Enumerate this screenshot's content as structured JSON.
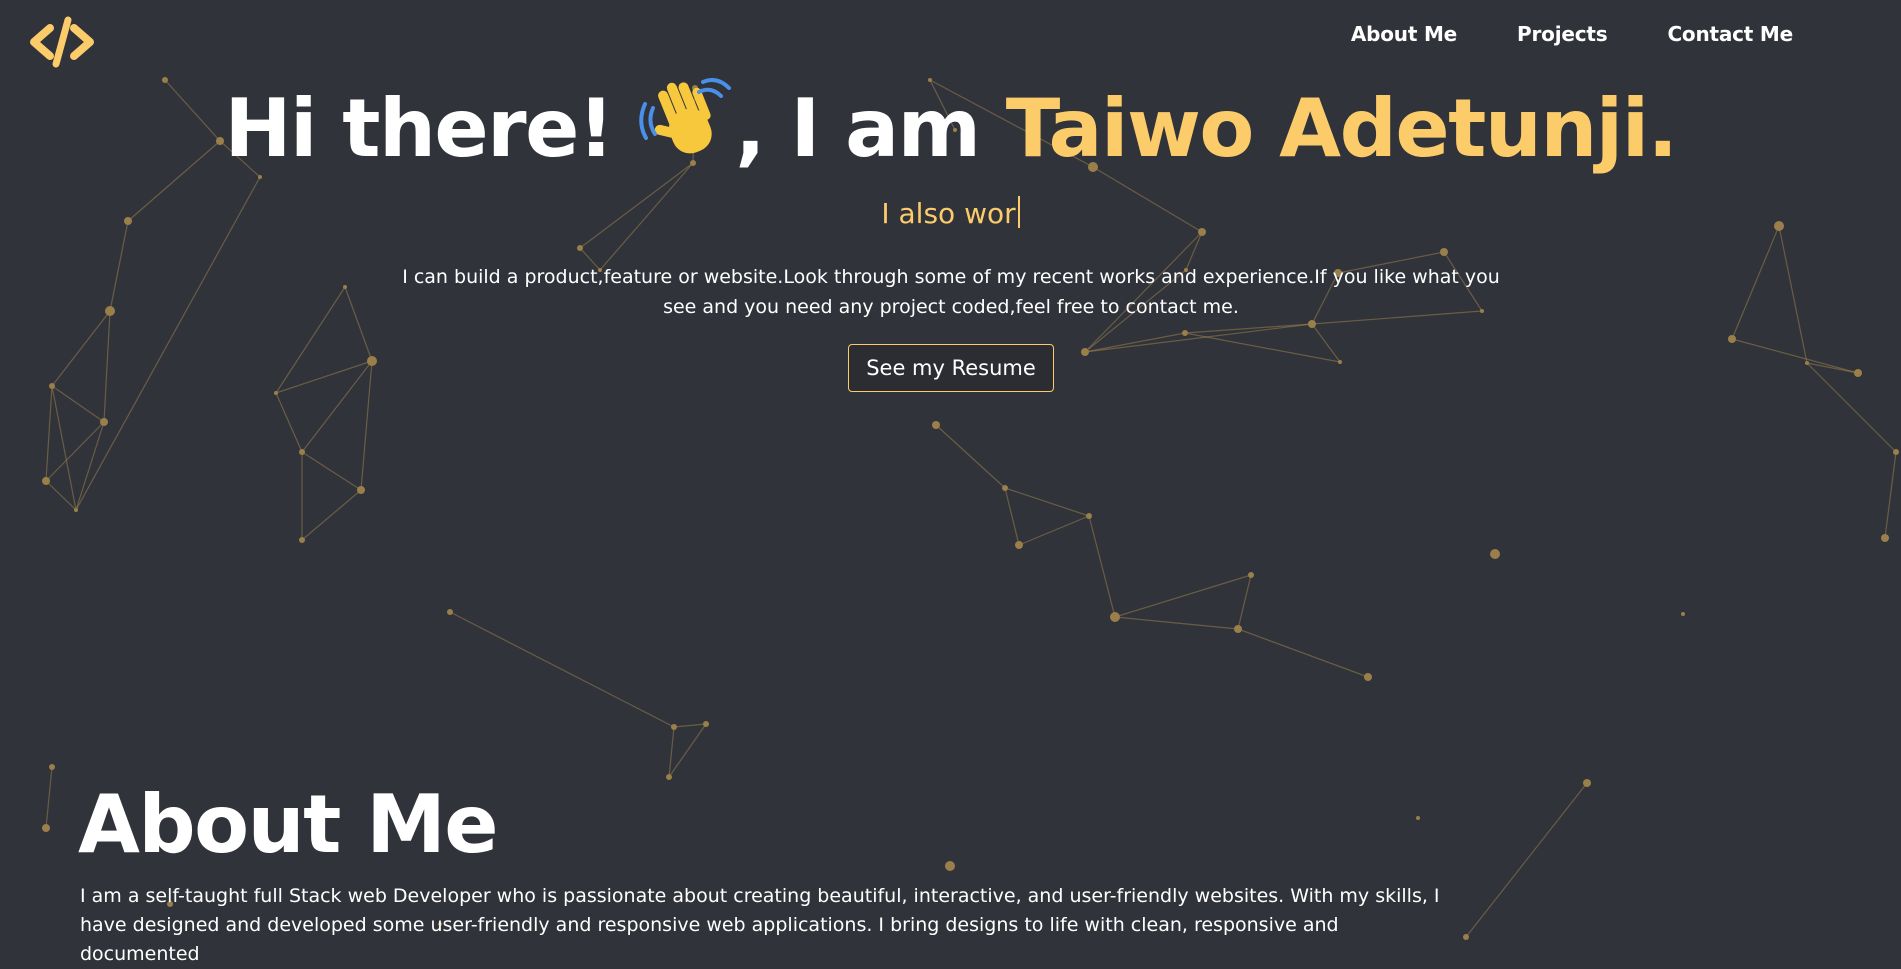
{
  "nav": {
    "logo": "code-logo-icon",
    "items": [
      {
        "label": "About Me"
      },
      {
        "label": "Projects"
      },
      {
        "label": "Contact Me"
      }
    ]
  },
  "hero": {
    "greeting": "Hi there!",
    "wave_icon": "waving-hand-icon",
    "iam": ", I am",
    "name": "Taiwo Adetunji.",
    "typed_text": "I also wor",
    "intro": "I can build a product,feature or website.Look through some of my recent works and experience.If you like what you see and you need any project coded,feel free to contact me.",
    "resume_button": "See my Resume"
  },
  "about": {
    "title": "About Me",
    "text": "I am a self-taught full Stack web Developer who is passionate about creating beautiful, interactive, and user-friendly websites. With my skills, I have designed and developed some user-friendly and responsive web applications. I bring designs to life with clean, responsive and documented"
  },
  "colors": {
    "background": "#31333b",
    "accent": "#fccb6a",
    "text": "#ffffff"
  }
}
